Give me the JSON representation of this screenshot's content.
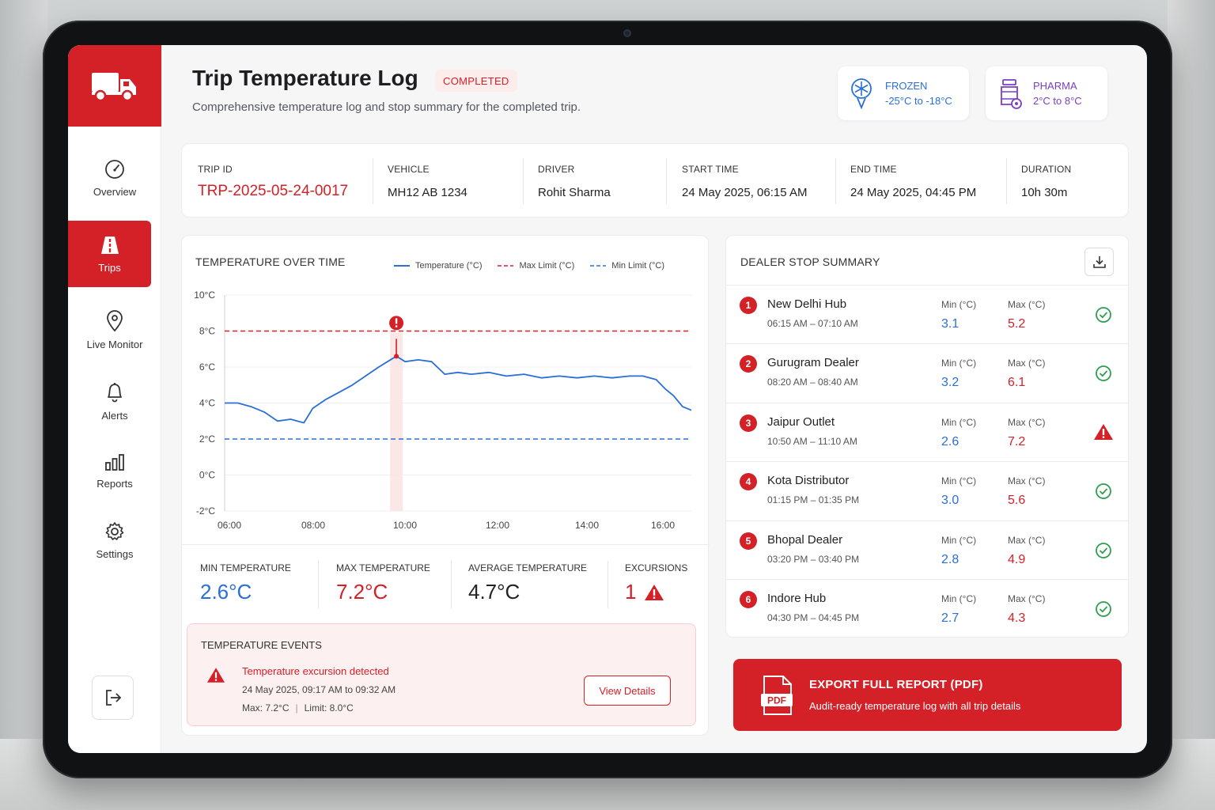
{
  "header": {
    "title": "Trip Temperature Log",
    "status_badge": "COMPLETED",
    "subtitle": "Comprehensive temperature log and stop summary for the completed trip."
  },
  "ranges": {
    "frozen": {
      "label": "FROZEN",
      "range": "-25°C to -18°C",
      "icon": "snowflake-thermometer-icon",
      "color": "#2a6fd6"
    },
    "pharma": {
      "label": "PHARMA",
      "range": "2°C to 8°C",
      "icon": "medicine-bottle-icon",
      "color": "#7a3fc7"
    }
  },
  "sidebar": {
    "logo_icon": "truck-icon",
    "items": [
      {
        "label": "Overview",
        "icon": "gauge-icon",
        "active": false
      },
      {
        "label": "Trips",
        "icon": "road-icon",
        "active": true
      },
      {
        "label": "Live Monitor",
        "icon": "location-pin-icon",
        "active": false
      },
      {
        "label": "Alerts",
        "icon": "bell-icon",
        "active": false
      },
      {
        "label": "Reports",
        "icon": "bar-chart-icon",
        "active": false
      },
      {
        "label": "Settings",
        "icon": "gear-icon",
        "active": false
      }
    ],
    "logout_icon": "logout-icon"
  },
  "trip": {
    "trip_id_label": "TRIP ID",
    "trip_id": "TRP-2025-05-24-0017",
    "vehicle_label": "VEHICLE",
    "vehicle": "MH12 AB 1234",
    "driver_label": "DRIVER",
    "driver": "Rohit Sharma",
    "start_label": "START TIME",
    "start": "24 May 2025, 06:15 AM",
    "end_label": "END TIME",
    "end": "24 May 2025, 04:45 PM",
    "duration_label": "DURATION",
    "duration": "10h 30m"
  },
  "chart_panel": {
    "title": "TEMPERATURE OVER TIME",
    "legend_temp": "Temperature (°C)",
    "legend_max": "Max Limit (°C)",
    "legend_min": "Min Limit (°C)"
  },
  "chart_data": {
    "type": "line",
    "x_tick_labels": [
      "06:00",
      "08:00",
      "10:00",
      "12:00",
      "14:00",
      "16:00"
    ],
    "y_tick_labels": [
      "10°C",
      "8°C",
      "6°C",
      "4°C",
      "2°C",
      "0°C",
      "-2°C"
    ],
    "ylim": [
      -2,
      10
    ],
    "xlim_hours": [
      6.0,
      16.6
    ],
    "max_limit": 8,
    "min_limit": 2,
    "excursion_x_hours": 9.9,
    "series": [
      {
        "color": "#2a6fd6",
        "x": [
          6.0,
          6.3,
          6.6,
          6.9,
          7.2,
          7.5,
          7.8,
          8.0,
          8.3,
          8.6,
          8.9,
          9.2,
          9.5,
          9.7,
          9.9,
          10.1,
          10.4,
          10.7,
          11.0,
          11.3,
          11.6,
          12.0,
          12.4,
          12.8,
          13.2,
          13.6,
          14.0,
          14.4,
          14.8,
          15.2,
          15.5,
          15.8,
          16.0,
          16.2,
          16.4,
          16.6
        ],
        "y": [
          4.0,
          4.0,
          3.8,
          3.5,
          3.0,
          3.1,
          2.9,
          3.7,
          4.2,
          4.6,
          5.0,
          5.5,
          6.0,
          6.3,
          6.6,
          6.3,
          6.4,
          6.3,
          5.6,
          5.7,
          5.6,
          5.7,
          5.5,
          5.6,
          5.4,
          5.5,
          5.4,
          5.5,
          5.4,
          5.5,
          5.5,
          5.3,
          4.8,
          4.4,
          3.8,
          3.6
        ]
      }
    ]
  },
  "stats": {
    "min_label": "MIN TEMPERATURE",
    "min": "2.6°C",
    "max_label": "MAX TEMPERATURE",
    "max": "7.2°C",
    "avg_label": "AVERAGE TEMPERATURE",
    "avg": "4.7°C",
    "exc_label": "EXCURSIONS",
    "exc": "1"
  },
  "events": {
    "title": "TEMPERATURE EVENTS",
    "headline": "Temperature excursion detected",
    "time": "24 May 2025, 09:17 AM to 09:32 AM",
    "max": "Max: 7.2°C",
    "separator": "|",
    "limit": "Limit: 8.0°C",
    "button": "View Details"
  },
  "dealer": {
    "title": "DEALER STOP SUMMARY",
    "download_icon": "download-icon",
    "stops": [
      {
        "num": "1",
        "name": "New Delhi Hub",
        "time": "06:15 AM – 07:10 AM",
        "min_label": "Min (°C)",
        "min": "3.1",
        "max_label": "Max (°C)",
        "max": "5.2",
        "status": "ok"
      },
      {
        "num": "2",
        "name": "Gurugram Dealer",
        "time": "08:20 AM – 08:40 AM",
        "min_label": "Min (°C)",
        "min": "3.2",
        "max_label": "Max (°C)",
        "max": "6.1",
        "status": "ok"
      },
      {
        "num": "3",
        "name": "Jaipur Outlet",
        "time": "10:50 AM – 11:10 AM",
        "min_label": "Min (°C)",
        "min": "2.6",
        "max_label": "Max (°C)",
        "max": "7.2",
        "status": "warning"
      },
      {
        "num": "4",
        "name": "Kota Distributor",
        "time": "01:15 PM – 01:35 PM",
        "min_label": "Min (°C)",
        "min": "3.0",
        "max_label": "Max (°C)",
        "max": "5.6",
        "status": "ok"
      },
      {
        "num": "5",
        "name": "Bhopal Dealer",
        "time": "03:20 PM – 03:40 PM",
        "min_label": "Min (°C)",
        "min": "2.8",
        "max_label": "Max (°C)",
        "max": "4.9",
        "status": "ok"
      },
      {
        "num": "6",
        "name": "Indore Hub",
        "time": "04:30 PM – 04:45 PM",
        "min_label": "Min (°C)",
        "min": "2.7",
        "max_label": "Max (°C)",
        "max": "4.3",
        "status": "ok"
      }
    ]
  },
  "export": {
    "title": "EXPORT FULL REPORT (PDF)",
    "subtitle": "Audit-ready temperature log with all trip details",
    "icon_text": "PDF"
  },
  "colors": {
    "accent": "#d42027",
    "blue": "#2a6fd6",
    "green": "#2e9e4f"
  }
}
